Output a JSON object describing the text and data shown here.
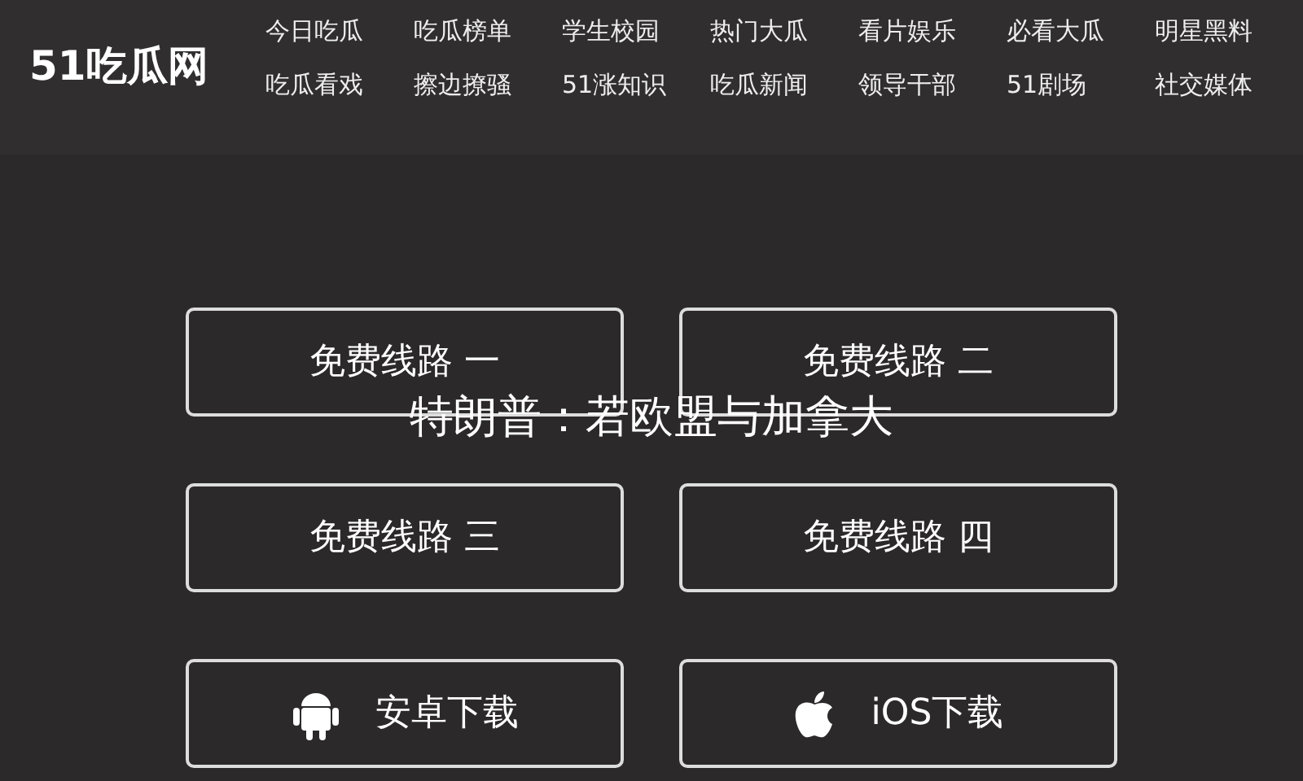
{
  "logo": "51吃瓜网",
  "nav": [
    "今日吃瓜",
    "吃瓜榜单",
    "学生校园",
    "热门大瓜",
    "看片娱乐",
    "必看大瓜",
    "明星黑料",
    "吃瓜看戏",
    "擦边撩骚",
    "51涨知识",
    "吃瓜新闻",
    "领导干部",
    "51剧场",
    "社交媒体"
  ],
  "lines": [
    "免费线路 一",
    "免费线路 二",
    "免费线路 三",
    "免费线路 四"
  ],
  "downloads": [
    {
      "kind": "android",
      "label": "安卓下载"
    },
    {
      "kind": "ios",
      "label": "iOS下载"
    }
  ],
  "headline": "特朗普：若欧盟与加拿大"
}
